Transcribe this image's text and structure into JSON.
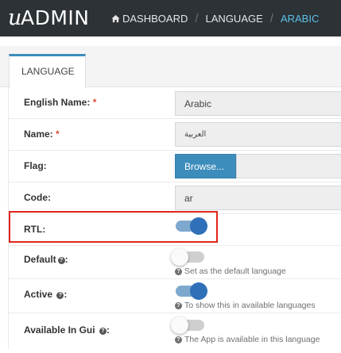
{
  "navbar": {
    "brand_u": "u",
    "brand_admin": "ADMIN",
    "breadcrumbs": [
      {
        "label": "DASHBOARD",
        "icon": "home-icon"
      },
      {
        "label": "LANGUAGE"
      },
      {
        "label": "ARABIC",
        "active": true
      }
    ],
    "separator": "/"
  },
  "tab": {
    "label": "LANGUAGE"
  },
  "form": {
    "english_name": {
      "label": "English Name:",
      "required": "*",
      "value": "Arabic"
    },
    "name": {
      "label": "Name:",
      "required": "*",
      "value": "العربية"
    },
    "flag": {
      "label": "Flag:",
      "button": "Browse..."
    },
    "code": {
      "label": "Code:",
      "value": "ar"
    },
    "rtl": {
      "label": "RTL:",
      "on": true
    },
    "default": {
      "label": "Default",
      "colon": ":",
      "on": false,
      "help": "Set as the default language"
    },
    "active": {
      "label": "Active",
      "colon": ":",
      "on": true,
      "help": "To show this in available languages"
    },
    "available_in_gui": {
      "label": "Available In Gui",
      "colon": ":",
      "on": false,
      "help": "The App is available in this language"
    }
  },
  "colors": {
    "navbar": "#2c3236",
    "accent": "#3c8dbc",
    "active_crumb": "#5dc0e8",
    "toggle_on": "#2f70b8",
    "highlight": "#e1251b"
  }
}
